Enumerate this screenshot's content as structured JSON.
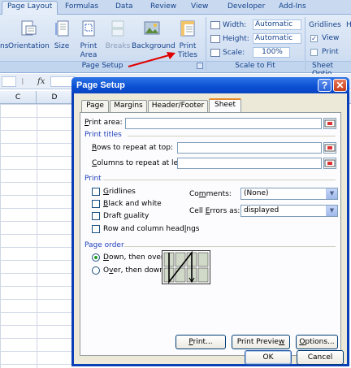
{
  "ribbon": {
    "tabs": [
      {
        "label": "Page Layout",
        "active": true
      },
      {
        "label": "Formulas"
      },
      {
        "label": "Data"
      },
      {
        "label": "Review"
      },
      {
        "label": "View"
      },
      {
        "label": "Developer"
      },
      {
        "label": "Add-Ins"
      }
    ],
    "page_setup_group": {
      "label": "Page Setup",
      "buttons": {
        "margins_partial": "ns",
        "orientation": "Orientation",
        "size": "Size",
        "print_area": [
          "Print",
          "Area"
        ],
        "breaks": "Breaks",
        "background": "Background",
        "print_titles": [
          "Print",
          "Titles"
        ]
      }
    },
    "scale_group": {
      "label": "Scale to Fit",
      "width_label": "Width:",
      "width_value": "Automatic",
      "height_label": "Height:",
      "height_value": "Automatic",
      "scale_label": "Scale:",
      "scale_value": "100%"
    },
    "sheet_options_group": {
      "label": "Sheet Optio",
      "gridlines": "Gridlines",
      "view": "View",
      "print": "Print",
      "view_checked": true,
      "print_checked": false,
      "headings_partial": "H"
    }
  },
  "sheet": {
    "fx": "fx",
    "columns": [
      "C",
      "D"
    ]
  },
  "dialog": {
    "title": "Page Setup",
    "help": "?",
    "close": "✕",
    "tabs": [
      "Page",
      "Margins",
      "Header/Footer",
      "Sheet"
    ],
    "active_tab": "Sheet",
    "print_area_label": "Print area:",
    "print_titles_section": "Print titles",
    "rows_repeat_label": "Rows to repeat at top:",
    "cols_repeat_label": "Columns to repeat at left:",
    "print_section": "Print",
    "gridlines": "Gridlines",
    "black_white": "Black and white",
    "draft_quality": "Draft quality",
    "row_col_headings": "Row and column headings",
    "comments_label": "Comments:",
    "comments_value": "(None)",
    "cell_errors_label": "Cell errors as:",
    "cell_errors_value": "displayed",
    "page_order_section": "Page order",
    "down_then_over": "Down, then over",
    "over_then_down": "Over, then down",
    "selected_order": "Down, then over",
    "print_btn": "Print...",
    "preview_btn": "Print Preview",
    "options_btn": "Options...",
    "ok_btn": "OK",
    "cancel_btn": "Cancel"
  },
  "colors": {
    "ribbon_text": "#15428b",
    "dialog_title": "#0b4fd3",
    "section_text": "#1f3fb8",
    "arrow": "#e00000"
  }
}
